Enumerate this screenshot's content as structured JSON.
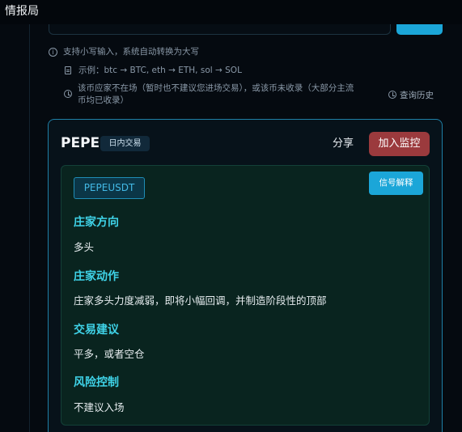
{
  "app": {
    "title": "情报局"
  },
  "hints": {
    "lowercase": "支持小写输入，系统自动转换为大写",
    "example": "示例：btc → BTC, eth → ETH, sol → SOL",
    "not_listed_line1": "该币应家不在场（暂时也不建议您进场交易），或该币未收录（大部分主流",
    "not_listed_line2": "币均已收录）",
    "history_link": "查询历史"
  },
  "card": {
    "symbol": "PEPE",
    "tag": "日内交易",
    "share_label": "分享",
    "monitor_label": "加入监控",
    "pair": "PEPEUSDT",
    "explain_label": "信号解释",
    "sections": [
      {
        "title": "庄家方向",
        "value": "多头"
      },
      {
        "title": "庄家动作",
        "value": "庄家多头力度减弱，即将小幅回调，并制造阶段性的顶部"
      },
      {
        "title": "交易建议",
        "value": "平多，或者空仓"
      },
      {
        "title": "风险控制",
        "value": "不建议入场"
      }
    ]
  },
  "colors": {
    "accent": "#1ba6d8",
    "section_title": "#3fd3e8",
    "monitor_button": "#9b3a3d",
    "card_border": "#1f7fa6"
  },
  "icons": [
    "info-icon",
    "document-icon",
    "clock-icon",
    "history-clock-icon"
  ]
}
